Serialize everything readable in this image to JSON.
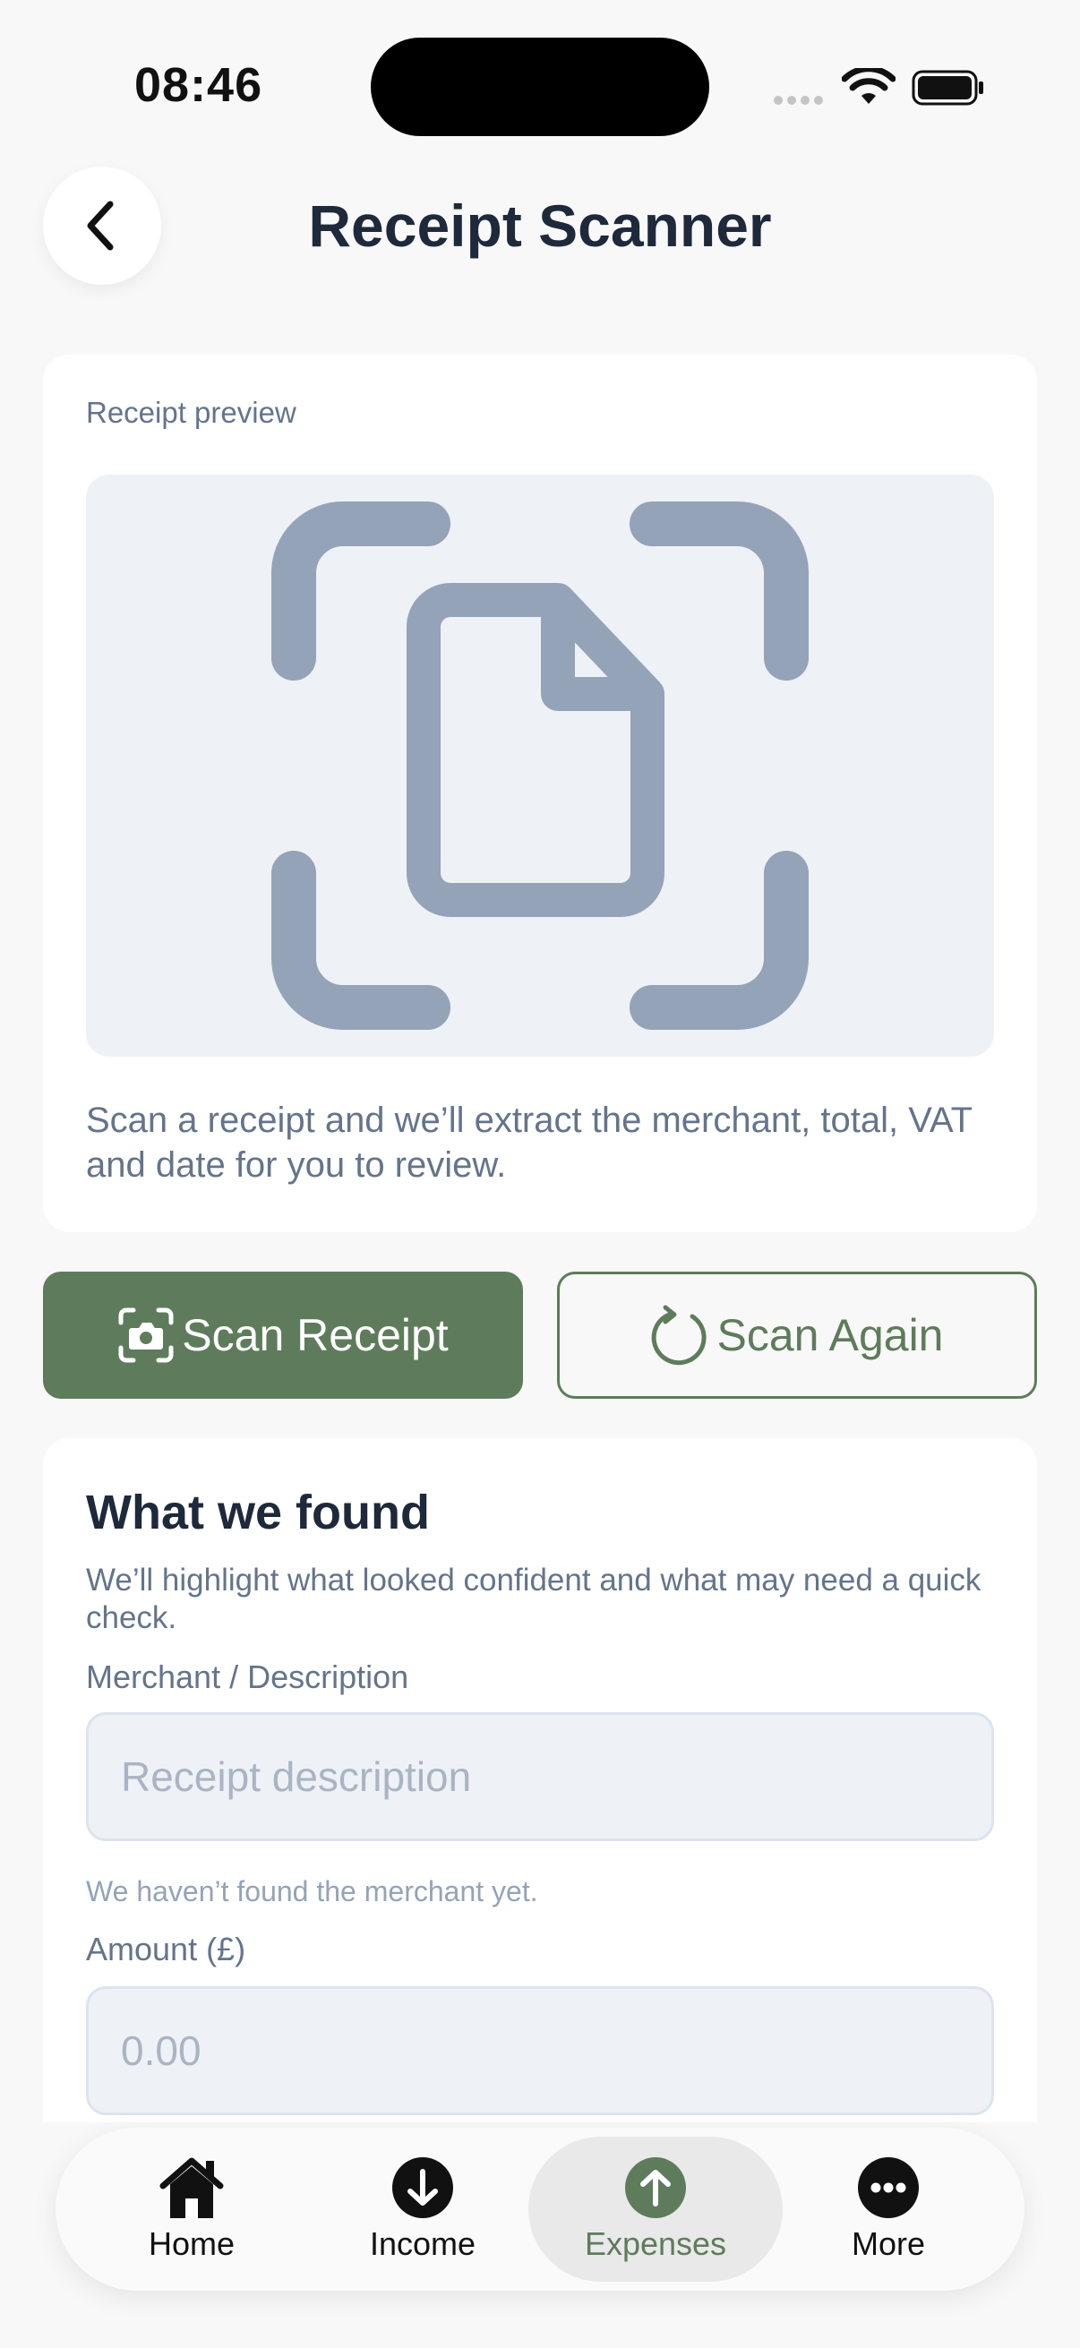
{
  "status": {
    "time": "08:46"
  },
  "header": {
    "title": "Receipt Scanner"
  },
  "preview": {
    "label": "Receipt preview",
    "help": "Scan a receipt and we’ll extract the merchant, total, VAT and date for you to review."
  },
  "actions": {
    "scan_label": "Scan Receipt",
    "rescan_label": "Scan Again"
  },
  "found": {
    "title": "What we found",
    "subtitle": "We’ll highlight what looked confident and what may need a quick check.",
    "merchant_label": "Merchant / Description",
    "merchant_placeholder": "Receipt description",
    "merchant_hint": "We haven’t found the merchant yet.",
    "amount_label": "Amount (£)",
    "amount_placeholder": "0.00"
  },
  "nav": {
    "home": "Home",
    "income": "Income",
    "expenses": "Expenses",
    "more": "More"
  },
  "colors": {
    "accent": "#5e7c5b",
    "muted": "#64748b",
    "field_bg": "#eef2f7"
  }
}
